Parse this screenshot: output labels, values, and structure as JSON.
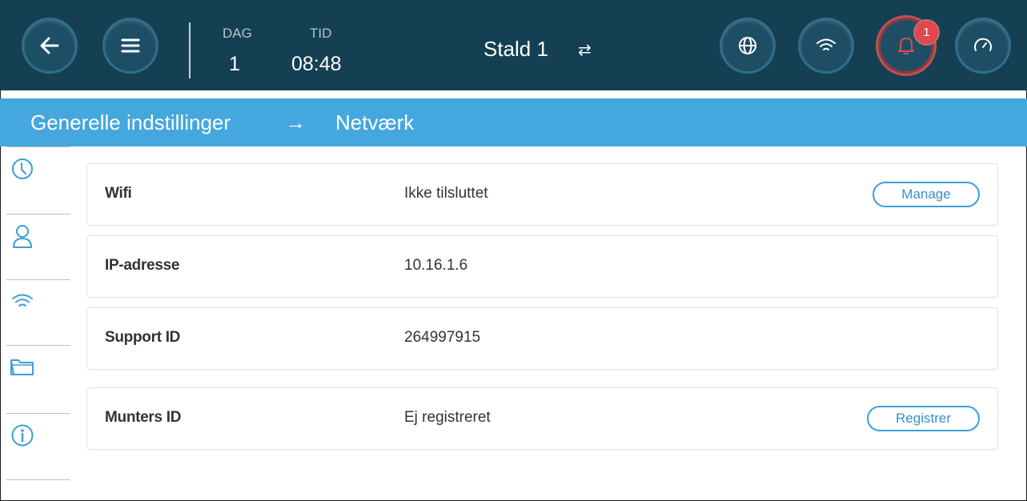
{
  "topbar": {
    "day_label": "DAG",
    "day_value": "1",
    "time_label": "TID",
    "time_value": "08:48",
    "house_name": "Stald 1",
    "swap_glyph": "⇄",
    "alarm_count": "1",
    "icons": [
      "back-arrow-icon",
      "menu-icon",
      "globe-icon",
      "wifi-icon",
      "bell-icon",
      "gauge-icon"
    ],
    "alarm_color": "#e0474f"
  },
  "breadcrumb": {
    "parent": "Generelle indstillinger",
    "separator": "→",
    "current": "Netværk"
  },
  "sidebar": {
    "items": [
      {
        "icon": "clock-icon"
      },
      {
        "icon": "user-icon"
      },
      {
        "icon": "wifi-icon",
        "active": true
      },
      {
        "icon": "folder-icon"
      },
      {
        "icon": "info-icon"
      }
    ]
  },
  "rows": [
    {
      "label": "Wifi",
      "value": "Ikke tilsluttet",
      "button": "Manage"
    },
    {
      "label": "IP-adresse",
      "value": "10.16.1.6"
    },
    {
      "label": "Support ID",
      "value": "264997915"
    },
    {
      "label": "Munters ID",
      "value": "Ej registreret",
      "button": "Registrer"
    }
  ],
  "colors": {
    "header": "#153f52",
    "breadcrumb_bar": "#44a7dd",
    "accent": "#3aa0d8"
  }
}
